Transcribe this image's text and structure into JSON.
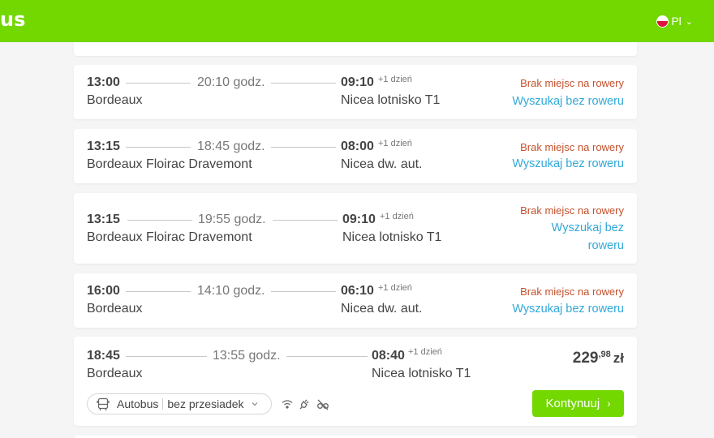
{
  "header": {
    "logo_text": "us",
    "language": "Pl"
  },
  "trips": [
    {
      "dep_time": "13:00",
      "duration": "20:10 godz.",
      "arr_time": "09:10",
      "next_day": "+1 dzień",
      "from": "Bordeaux",
      "to": "Nicea lotnisko T1",
      "status": "Brak miejsc na rowery",
      "action": "Wyszukaj bez roweru"
    },
    {
      "dep_time": "13:15",
      "duration": "18:45 godz.",
      "arr_time": "08:00",
      "next_day": "+1 dzień",
      "from": "Bordeaux Floirac Dravemont",
      "to": "Nicea dw. aut.",
      "status": "Brak miejsc na rowery",
      "action": "Wyszukaj bez roweru"
    },
    {
      "dep_time": "13:15",
      "duration": "19:55 godz.",
      "arr_time": "09:10",
      "next_day": "+1 dzień",
      "from": "Bordeaux Floirac Dravemont",
      "to": "Nicea lotnisko T1",
      "status": "Brak miejsc na rowery",
      "action_line1": "Wyszukaj bez",
      "action_line2": "roweru"
    },
    {
      "dep_time": "16:00",
      "duration": "14:10 godz.",
      "arr_time": "06:10",
      "next_day": "+1 dzień",
      "from": "Bordeaux",
      "to": "Nicea dw. aut.",
      "status": "Brak miejsc na rowery",
      "action": "Wyszukaj bez roweru"
    },
    {
      "dep_time": "18:45",
      "duration": "13:55 godz.",
      "arr_time": "08:40",
      "next_day": "+1 dzień",
      "from": "Bordeaux",
      "to": "Nicea lotnisko T1",
      "price_main": "229",
      "price_decimal": ",98",
      "currency": "zł",
      "vehicle": "Autobus",
      "transfer": "bez przesiadek",
      "continue_label": "Kontynuuj",
      "amenities": [
        "wifi-icon",
        "power-plug-icon",
        "no-bicycle-icon"
      ]
    }
  ],
  "colors": {
    "brand_green": "#73d700",
    "warning": "#c3502b",
    "link": "#31a8d8"
  }
}
